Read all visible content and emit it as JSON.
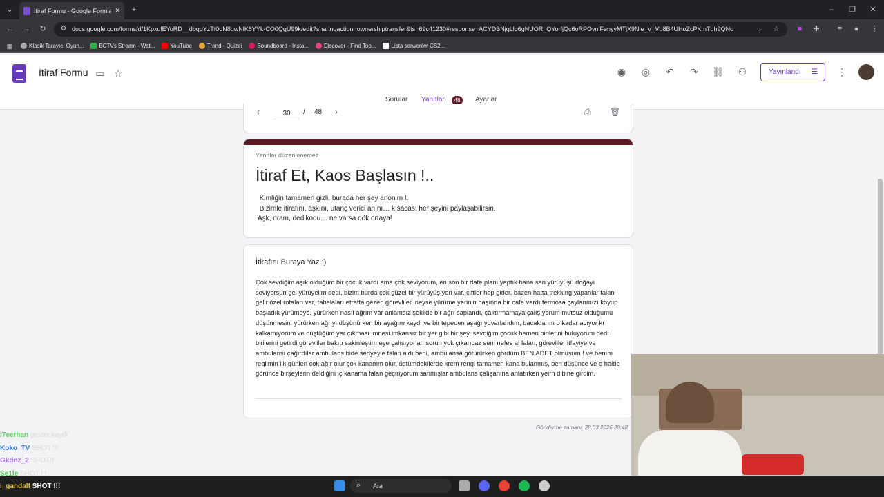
{
  "browser": {
    "tab_title": "İtiraf Formu - Google Formlar",
    "url": "docs.google.com/forms/d/1KpxulEYoRD__dbqgYzTt0oN8qwNlK6YYk-CO0QgU99k/edit?sharingaction=ownershiptransfer&ts=69c41230#response=ACYDBNjqLlo6gNUOR_QYorfjQc6oRPOvnlFenyyMTjX9Nle_V_Vp8B4UHoZcPKmTqh9QNo",
    "bookmarks": [
      "Klasik Tarayıcı Oyun...",
      "BCTVs Stream - Wat...",
      "YouTube",
      "Trend - Quizei",
      "Soundboard - Insta...",
      "Discover - Find Top...",
      "Lista serwerów CS2..."
    ]
  },
  "app": {
    "title": "İtiraf Formu",
    "publish_label": "Yayınlandı",
    "tabs": [
      "Sorular",
      "Yanıtlar",
      "Ayarlar"
    ],
    "responses_count": "48"
  },
  "pager": {
    "current": "30",
    "separator": "/",
    "total": "48"
  },
  "form": {
    "note": "Yanıtlar düzenlenemez",
    "title": "İtiraf Et, Kaos Başlasın !..",
    "description": " Kimliğin tamamen gizli, burada her şey anonim !.\n Bizimle itirafını, aşkını, utanç verici anını… kısacası her şeyini paylaşabilirsin.\nAşk, dram, dedikodu… ne varsa dök ortaya!"
  },
  "question": {
    "label": "İtirafını Buraya Yaz :)",
    "answer": "Çok sevdiğim aşık olduğum bir çocuk vardı ama çok seviyorum, en son bir date planı yaptık bana sen yürüyüşü doğayı seviyorsun gel yürüyelim dedi, bizim burda çok güzel bir yürüyüş yeri var, çiftler hep gider, bazen hatta trekking yapanlar falan gelir özel rotaları var, tabelaları etrafta gezen görevliler, neyse yürüme yerinin başında bir cafe vardı termosa çaylarımızı koyup başladık yürümeye,  yürürken nasıl ağrım var anlamsız şekilde bir ağrı saplandı, çaktırmamaya çalışıyorum mutsuz olduğumu düşünmesin, yürürken ağrıyı düşünürken bir ayağım kaydı ve bir tepeden aşağı yuvarlandım, bacaklarım o kadar acıyor kı kalkamıyorum ve düştüğüm yer çıkması imnesi imkansız bir yer gibi bir şey,  sevdiğim çocuk hemen birilerini buluyorum dedi birilerini getirdi görevliler bakıp sakinleştirmeye çalışıyorlar, sorun yok çıkarıcaz seni nefes al falan, görevliler itfayiye ve ambulansı çağırdılar ambulans bide sedyeyle falan aldı beni,  ambulansa götürürken gördüm BEN ADET olmuşum ! ve benım reglimin ilk günleri çok ağır olur çok kanamm olur, üstümdekilerde krem rengi tamamen kana bulanmış,  ben düşünce ve o halde görünce birşeylerin deldiğini iç kanama falan geçiriyorum sanmışlar ambulans çalışanına anlatırken yeirn dibine girdim."
  },
  "submitted": "Gönderme zamanı: 28.03.2026 20:48",
  "chat": [
    {
      "user": "i7eerhan",
      "msg": "gester kaydi",
      "color": "#5fd35f"
    },
    {
      "user": "Koko_TV",
      "msg": "SHOT !!!",
      "color": "#3a7bd5"
    },
    {
      "user": "Gkdnz_2",
      "msg": "SHOT!!!",
      "color": "#b06ee0"
    },
    {
      "user": "Se1le",
      "msg": "SHOT !!!",
      "color": "#4ec94e"
    },
    {
      "user": "i_gandalf",
      "msg": "SHOT !!!",
      "color": "#e0c040"
    }
  ],
  "taskbar": {
    "search_placeholder": "Ara"
  }
}
